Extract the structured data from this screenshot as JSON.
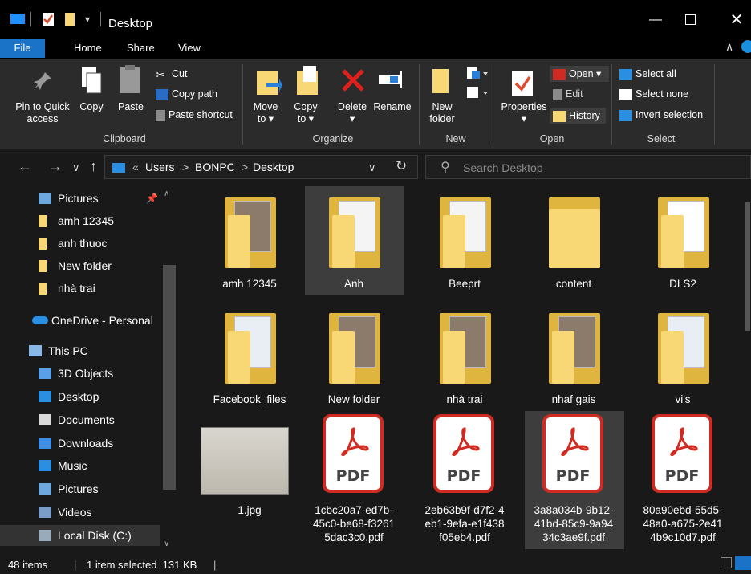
{
  "window": {
    "title": "Desktop"
  },
  "menu_tabs": [
    "File",
    "Home",
    "Share",
    "View"
  ],
  "ribbon": {
    "clipboard": {
      "title": "Clipboard",
      "pin_label_1": "Pin to Quick",
      "pin_label_2": "access",
      "copy_label": "Copy",
      "paste_label": "Paste",
      "cut_label": "Cut",
      "copy_path_label": "Copy path",
      "paste_shortcut_label": "Paste shortcut"
    },
    "organize": {
      "title": "Organize",
      "move_label_1": "Move",
      "move_label_2": "to ▾",
      "copy_label_1": "Copy",
      "copy_label_2": "to ▾",
      "delete_label": "Delete",
      "delete_arrow": "▾",
      "rename_label": "Rename"
    },
    "new": {
      "title": "New",
      "new_folder_1": "New",
      "new_folder_2": "folder"
    },
    "open": {
      "title": "Open",
      "properties_label": "Properties",
      "properties_arrow": "▾",
      "open_label": "Open ▾",
      "edit_label": "Edit",
      "history_label": "History"
    },
    "select": {
      "title": "Select",
      "select_all": "Select all",
      "select_none": "Select none",
      "invert_selection": "Invert selection"
    }
  },
  "address": {
    "crumbs": [
      "«",
      "Users",
      ">",
      "BONPC",
      ">",
      "Desktop"
    ],
    "search_placeholder": "Search Desktop"
  },
  "nav_pane": [
    {
      "label": "Pictures",
      "icon": "pictures-icon",
      "pinned": true
    },
    {
      "label": "amh 12345",
      "icon": "folder-icon"
    },
    {
      "label": "anh thuoc",
      "icon": "folder-icon"
    },
    {
      "label": "New folder",
      "icon": "folder-icon"
    },
    {
      "label": "nhà trai",
      "icon": "folder-icon"
    },
    {
      "label": "OneDrive - Personal",
      "icon": "cloud-icon"
    },
    {
      "label": "This PC",
      "icon": "computer-icon"
    },
    {
      "label": "3D Objects",
      "icon": "cube-icon"
    },
    {
      "label": "Desktop",
      "icon": "desktop-icon"
    },
    {
      "label": "Documents",
      "icon": "documents-icon"
    },
    {
      "label": "Downloads",
      "icon": "downloads-icon"
    },
    {
      "label": "Music",
      "icon": "music-icon"
    },
    {
      "label": "Pictures",
      "icon": "pictures-icon"
    },
    {
      "label": "Videos",
      "icon": "videos-icon"
    },
    {
      "label": "Local Disk (C:)",
      "icon": "disk-icon"
    }
  ],
  "items": [
    {
      "name": "amh 12345",
      "kind": "folder-photo"
    },
    {
      "name": "Anh",
      "kind": "folder-doc",
      "selected": true
    },
    {
      "name": "Beeprt",
      "kind": "folder-doc"
    },
    {
      "name": "content",
      "kind": "folder"
    },
    {
      "name": "DLS2",
      "kind": "folder-word"
    },
    {
      "name": "Facebook_files",
      "kind": "folder-web"
    },
    {
      "name": "New folder",
      "kind": "folder-photo"
    },
    {
      "name": "nhà trai",
      "kind": "folder-photo"
    },
    {
      "name": "nhaf gais",
      "kind": "folder-photo"
    },
    {
      "name": "vi's",
      "kind": "folder-web"
    },
    {
      "name": "1.jpg",
      "kind": "image"
    },
    {
      "name": "1cbc20a7-ed7b-45c0-be68-f32615dac3c0.pdf",
      "line1": "1cbc20a7-ed7b-",
      "line2": "45c0-be68-f3261",
      "line3": "5dac3c0.pdf",
      "kind": "pdf"
    },
    {
      "name": "2eb63b9f-d7f2-4eb1-9efa-e1f438f05eb4.pdf",
      "line1": "2eb63b9f-d7f2-4",
      "line2": "eb1-9efa-e1f438",
      "line3": "f05eb4.pdf",
      "kind": "pdf"
    },
    {
      "name": "3a8a034b-9b12-41bd-85c9-9a9434c3ae9f.pdf",
      "line1": "3a8a034b-9b12-",
      "line2": "41bd-85c9-9a94",
      "line3": "34c3ae9f.pdf",
      "kind": "pdf",
      "selected": true
    },
    {
      "name": "80a90ebd-55d5-48a0-a675-2e414b9c10d7.pdf",
      "line1": "80a90ebd-55d5-",
      "line2": "48a0-a675-2e41",
      "line3": "4b9c10d7.pdf",
      "kind": "pdf"
    }
  ],
  "pdf_badge": "PDF",
  "status": {
    "item_count": "48 items",
    "selection": "1 item selected  131 KB"
  },
  "colors": {
    "accent": "#1a73c6",
    "folder": "#f8d775",
    "pdf_red": "#d02b22"
  }
}
